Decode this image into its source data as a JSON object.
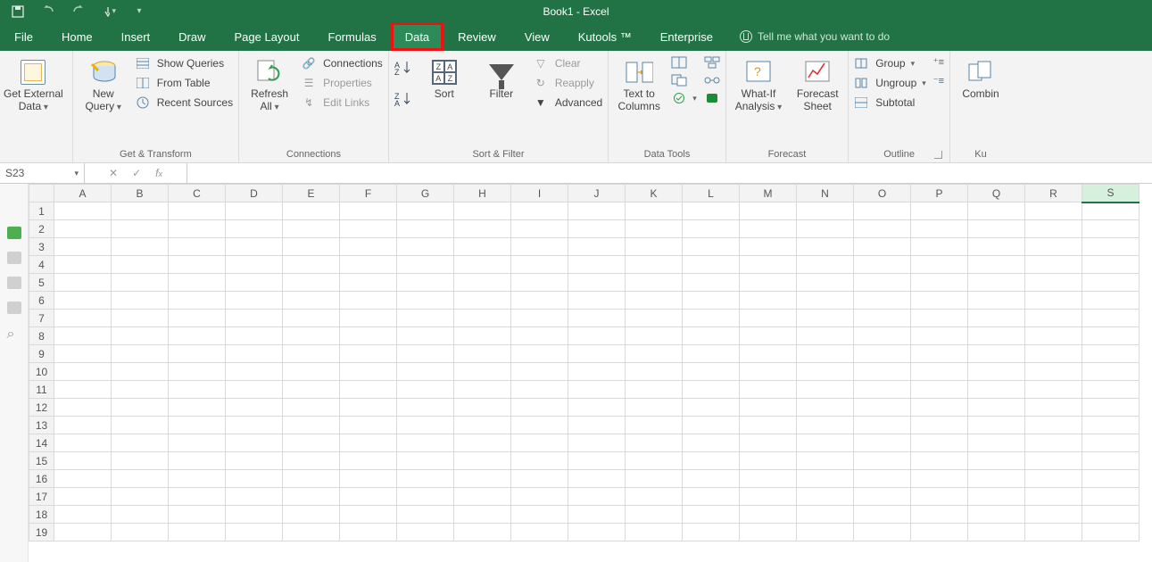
{
  "title": "Book1 - Excel",
  "qat": {
    "save": "save-icon",
    "undo": "undo-icon",
    "redo": "redo-icon",
    "touch": "touch-mode-icon",
    "customize": "customize-qat-icon"
  },
  "tabs": [
    "File",
    "Home",
    "Insert",
    "Draw",
    "Page Layout",
    "Formulas",
    "Data",
    "Review",
    "View",
    "Kutools ™",
    "Enterprise"
  ],
  "active_tab_index": 6,
  "tellme": "Tell me what you want to do",
  "ribbon": {
    "group_get_transform": {
      "label": "Get & Transform",
      "get_ext": "Get External\nData",
      "new_query": "New\nQuery",
      "show_queries": "Show Queries",
      "from_table": "From Table",
      "recent": "Recent Sources"
    },
    "group_connections": {
      "label": "Connections",
      "refresh": "Refresh\nAll",
      "connections": "Connections",
      "properties": "Properties",
      "edit_links": "Edit Links"
    },
    "group_sort_filter": {
      "label": "Sort & Filter",
      "sort": "Sort",
      "filter": "Filter",
      "clear": "Clear",
      "reapply": "Reapply",
      "advanced": "Advanced"
    },
    "group_data_tools": {
      "label": "Data Tools",
      "t2c": "Text to\nColumns"
    },
    "group_forecast": {
      "label": "Forecast",
      "whatif": "What-If\nAnalysis",
      "fsheet": "Forecast\nSheet"
    },
    "group_outline": {
      "label": "Outline",
      "group": "Group",
      "ungroup": "Ungroup",
      "subtotal": "Subtotal"
    },
    "group_kutools": {
      "label": "Ku",
      "combine": "Combin"
    }
  },
  "namebox": "S23",
  "formula": "",
  "columns": [
    "A",
    "B",
    "C",
    "D",
    "E",
    "F",
    "G",
    "H",
    "I",
    "J",
    "K",
    "L",
    "M",
    "N",
    "O",
    "P",
    "Q",
    "R",
    "S"
  ],
  "selected_col": "S",
  "row_count": 19
}
